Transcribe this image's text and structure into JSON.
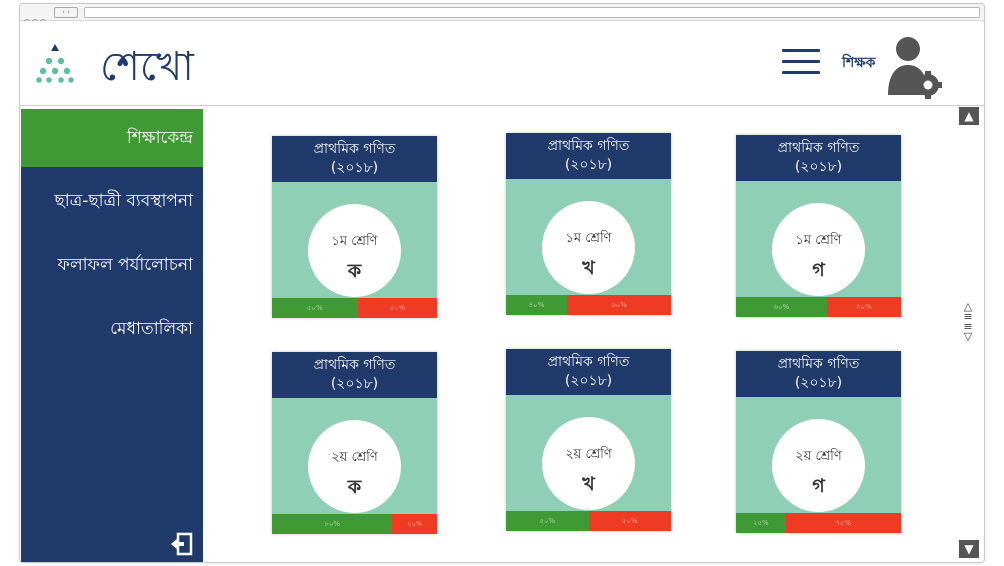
{
  "app": {
    "name": "শেখো",
    "user_label": "শিক্ষক",
    "colors": {
      "navy": "#1f3a6b",
      "green": "#3f9a35",
      "mint": "#8ecfb5",
      "red": "#ef3b24",
      "logo_teal": "#5fbfa3"
    }
  },
  "sidebar": {
    "items": [
      {
        "label": "শিক্ষাকেন্দ্র",
        "active": true
      },
      {
        "label": "ছাত্র-ছাত্রী ব্যবস্থাপনা",
        "active": false
      },
      {
        "label": "ফলাফল পর্যালোচনা",
        "active": false
      },
      {
        "label": "মেধাতালিকা",
        "active": false
      }
    ],
    "logout_icon": "logout-icon"
  },
  "cards": [
    {
      "title": "প্রাথমিক গণিত",
      "year": "(২০১৮)",
      "grade": "১ম শ্রেণি",
      "section": "ক",
      "green_label": "৫০%",
      "red_label": "৫০%",
      "green_fraction": 0.52
    },
    {
      "title": "প্রাথমিক গণিত",
      "year": "(২০১৮)",
      "grade": "১ম শ্রেণি",
      "section": "খ",
      "green_label": "৪০%",
      "red_label": "৬০%",
      "green_fraction": 0.37
    },
    {
      "title": "প্রাথমিক গণিত",
      "year": "(২০১৮)",
      "grade": "১ম শ্রেণি",
      "section": "গ",
      "green_label": "৬০%",
      "red_label": "৪০%",
      "green_fraction": 0.55
    },
    {
      "title": "প্রাথমিক গণিত",
      "year": "(২০১৮)",
      "grade": "২য় শ্রেণি",
      "section": "ক",
      "green_label": "৮০%",
      "red_label": "২০%",
      "green_fraction": 0.73
    },
    {
      "title": "প্রাথমিক গণিত",
      "year": "(২০১৮)",
      "grade": "২য় শ্রেণি",
      "section": "খ",
      "green_label": "৫০%",
      "red_label": "৫০%",
      "green_fraction": 0.5
    },
    {
      "title": "প্রাথমিক গণিত",
      "year": "(২০১৮)",
      "grade": "২য় শ্রেণি",
      "section": "গ",
      "green_label": "২৫%",
      "red_label": "৭৫%",
      "green_fraction": 0.3
    }
  ],
  "scrollbar": {
    "up_icon": "chevron-up-icon",
    "down_icon": "chevron-down-icon",
    "handle_icon": "scroll-handle-icon"
  }
}
